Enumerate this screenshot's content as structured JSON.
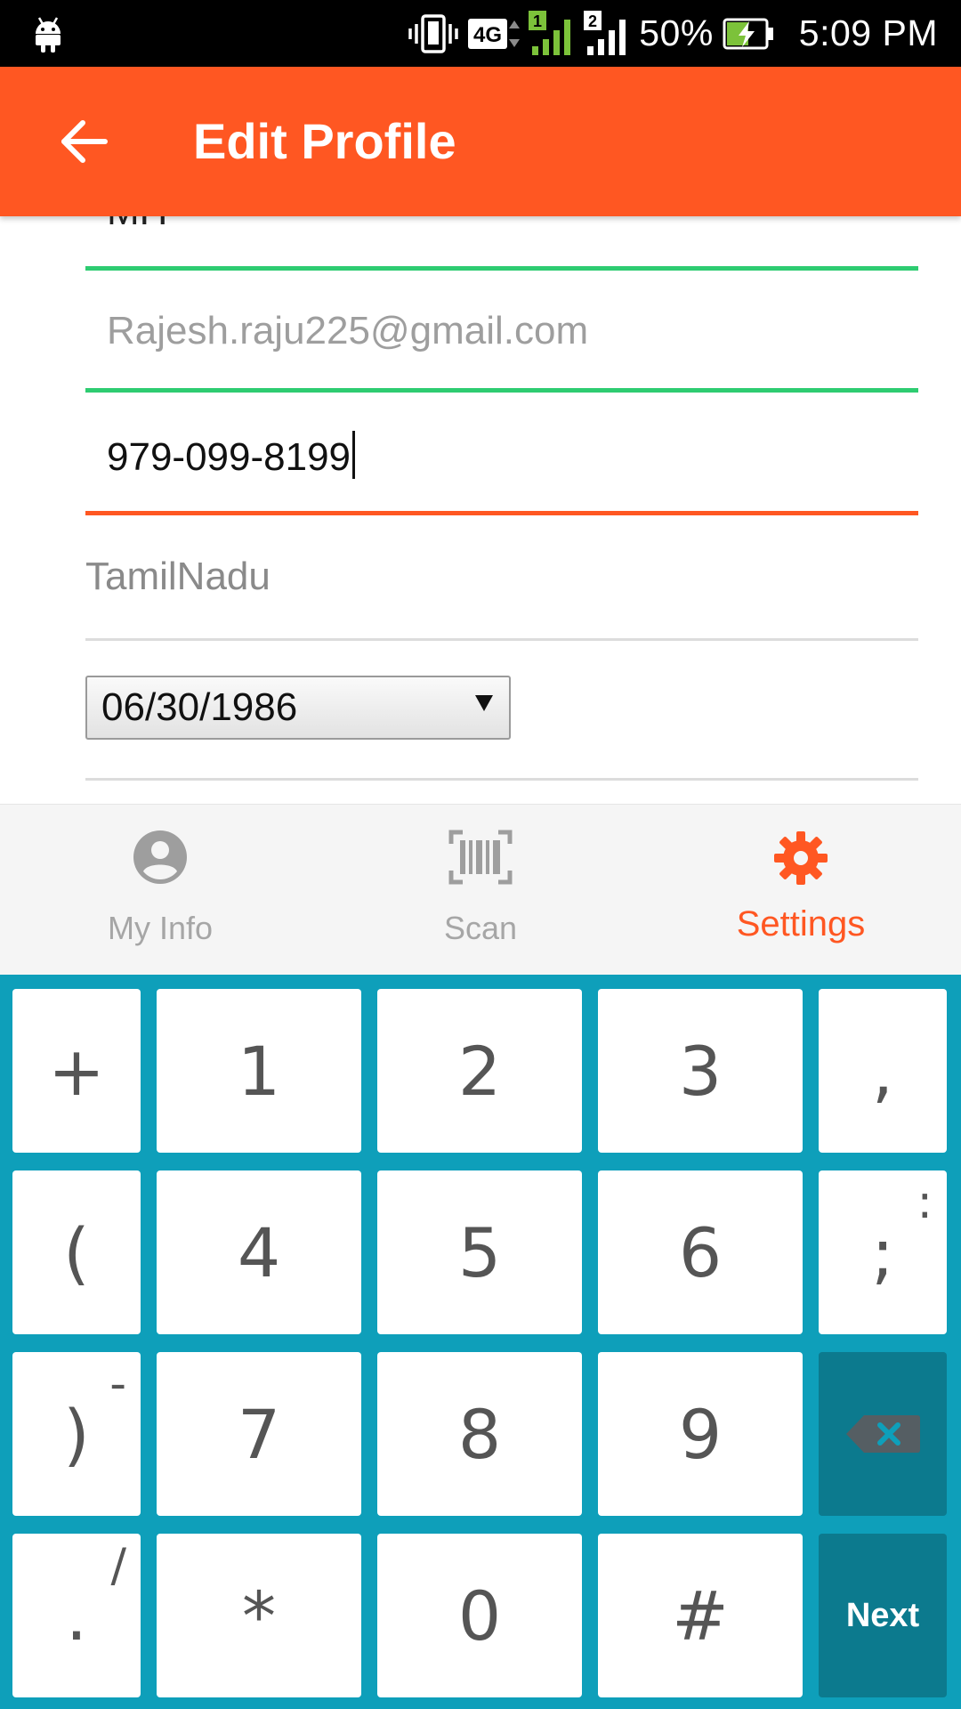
{
  "status_bar": {
    "network": "4G",
    "sim1": "1",
    "sim2": "2",
    "battery": "50%",
    "time": "5:09 PM",
    "icons": [
      "android-icon",
      "vibrate-icon",
      "4g-icon",
      "signal-sim1-icon",
      "signal-sim2-icon",
      "battery-charging-icon"
    ]
  },
  "app_bar": {
    "title": "Edit Profile",
    "back_icon": "arrow-back-icon",
    "color": "#ff5722"
  },
  "form": {
    "cutoff_field_text": "MH",
    "email": "Rajesh.raju225@gmail.com",
    "phone": "979-099-8199",
    "state": "TamilNadu",
    "dob": "06/30/1986"
  },
  "bottom_nav": {
    "items": [
      {
        "label": "My Info",
        "icon": "account-circle-icon",
        "active": false
      },
      {
        "label": "Scan",
        "icon": "barcode-icon",
        "active": false
      },
      {
        "label": "Settings",
        "icon": "gear-icon",
        "active": true
      }
    ]
  },
  "keyboard": {
    "rows": [
      [
        {
          "main": "+"
        },
        {
          "main": "1"
        },
        {
          "main": "2"
        },
        {
          "main": "3"
        },
        {
          "main": ","
        }
      ],
      [
        {
          "main": "(",
          "sub": ""
        },
        {
          "main": "4"
        },
        {
          "main": "5"
        },
        {
          "main": "6"
        },
        {
          "main": ";",
          "sub": ":"
        }
      ],
      [
        {
          "main": ")",
          "sub": "-"
        },
        {
          "main": "7"
        },
        {
          "main": "8"
        },
        {
          "main": "9"
        },
        {
          "icon": "backspace-icon"
        }
      ],
      [
        {
          "main": ".",
          "sub": "/"
        },
        {
          "main": "*"
        },
        {
          "main": "0"
        },
        {
          "main": "#"
        },
        {
          "label": "Next"
        }
      ]
    ],
    "colors": {
      "background": "#0e9fba",
      "special_key": "#0c7a8e"
    }
  }
}
